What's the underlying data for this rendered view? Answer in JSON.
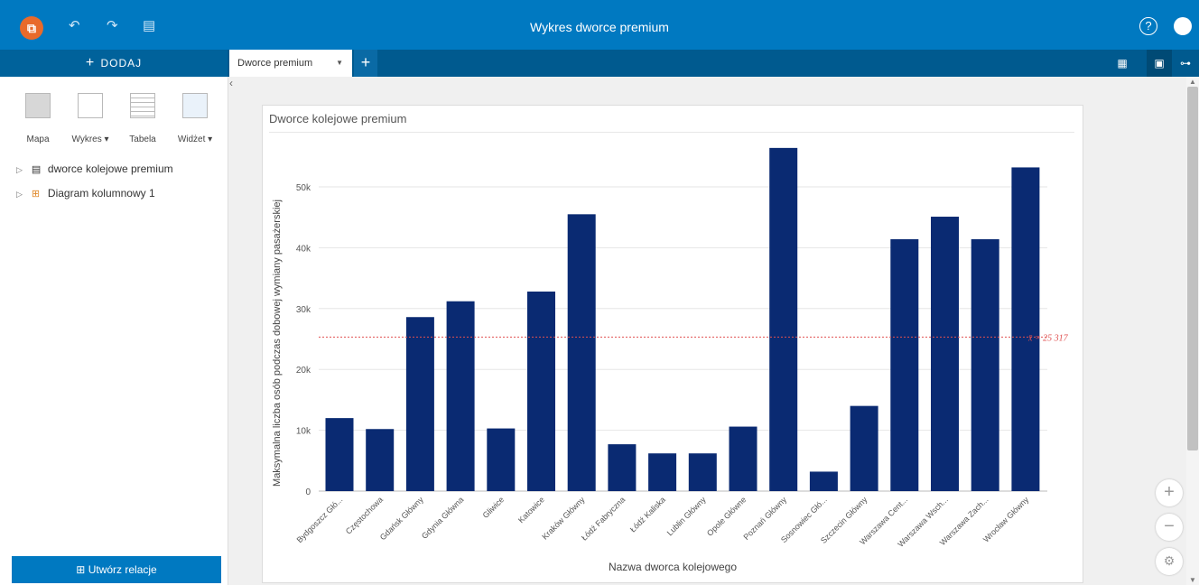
{
  "header": {
    "title": "Wykres dworce premium",
    "undo_icon": "undo-icon",
    "redo_icon": "redo-icon",
    "save_icon": "save-icon",
    "help_icon": "help-icon"
  },
  "toolbar": {
    "add_label": "DODAJ",
    "page_tab": "Dworce premium"
  },
  "left_panel": {
    "widgets": [
      {
        "label": "Mapa"
      },
      {
        "label": "Wykres ▾"
      },
      {
        "label": "Tabela"
      },
      {
        "label": "Widżet ▾"
      }
    ],
    "tree": [
      {
        "label": "dworce kolejowe premium",
        "icon": "table-icon"
      },
      {
        "label": "Diagram kolumnowy 1",
        "icon": "bar-chart-icon"
      }
    ],
    "create_relations": "Utwórz relacje"
  },
  "colors": {
    "primary": "#0079c1",
    "bar": "#0a2a72",
    "mean_line": "#e05050"
  },
  "chart_data": {
    "type": "bar",
    "title": "Dworce kolejowe premium",
    "xlabel": "Nazwa dworca kolejowego",
    "ylabel": "Maksymalna liczba osób podczas dobowej wymiany pasażerskiej",
    "ylim": [
      0,
      60000
    ],
    "y_ticks": [
      {
        "value": 0,
        "label": "0"
      },
      {
        "value": 10000,
        "label": "10k"
      },
      {
        "value": 20000,
        "label": "20k"
      },
      {
        "value": 30000,
        "label": "30k"
      },
      {
        "value": 40000,
        "label": "40k"
      },
      {
        "value": 50000,
        "label": "50k"
      }
    ],
    "categories": [
      "Bydgoszcz Głó...",
      "Częstochowa",
      "Gdańsk Główny",
      "Gdynia Główna",
      "Gliwice",
      "Katowice",
      "Kraków Główny",
      "Łódź Fabryczna",
      "Łódź Kaliska",
      "Lublin Główny",
      "Opole Główne",
      "Poznań Główny",
      "Sosnowiec Głó...",
      "Szczecin Główny",
      "Warszawa Cent...",
      "Warszawa Wsch...",
      "Warszawa Zach...",
      "Wrocław Główny"
    ],
    "values": [
      12000,
      10200,
      28600,
      31200,
      10300,
      32800,
      45500,
      7700,
      6200,
      6200,
      10600,
      56400,
      3200,
      14000,
      41400,
      45100,
      41400,
      53200
    ],
    "mean": {
      "value": 25317,
      "label": "x̄ = 25 317"
    },
    "grid": true,
    "legend": "none"
  }
}
